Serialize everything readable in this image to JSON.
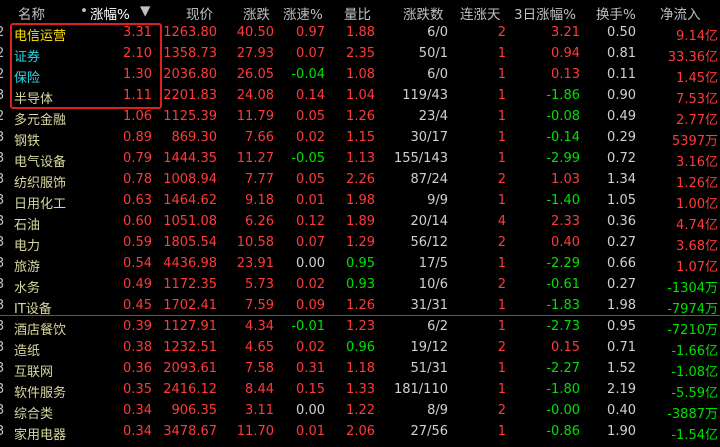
{
  "header": {
    "name": "名称",
    "pct": "涨幅%",
    "price": "现价",
    "chg": "涨跌",
    "speed": "涨速%",
    "vol_ratio": "量比",
    "up_down": "涨跌数",
    "streak": "连涨天",
    "pct3": "3日涨幅%",
    "turnover": "换手%",
    "inflow": "净流入"
  },
  "rows": [
    {
      "idx": "2",
      "name": "电信运营",
      "pct": "3.31",
      "price": "1263.80",
      "chg": "40.50",
      "speed": "0.97",
      "vr": "1.88",
      "ud": "6/0",
      "streak": "2",
      "p3": "3.21",
      "to": "0.50",
      "inflow": "9.14亿",
      "name_color": "yel",
      "speed_color": "red",
      "vr_color": "red",
      "p3_color": "red",
      "inflow_color": "red"
    },
    {
      "idx": "2",
      "name": "证券",
      "pct": "2.10",
      "price": "1358.73",
      "chg": "27.93",
      "speed": "0.07",
      "vr": "2.35",
      "ud": "50/1",
      "streak": "1",
      "p3": "0.94",
      "to": "0.81",
      "inflow": "33.36亿",
      "name_color": "cyan",
      "speed_color": "red",
      "vr_color": "red",
      "p3_color": "red",
      "inflow_color": "red"
    },
    {
      "idx": "2",
      "name": "保险",
      "pct": "1.30",
      "price": "2036.80",
      "chg": "26.05",
      "speed": "-0.04",
      "vr": "1.08",
      "ud": "6/0",
      "streak": "1",
      "p3": "0.13",
      "to": "0.11",
      "inflow": "1.45亿",
      "name_color": "cyan",
      "speed_color": "grn",
      "vr_color": "red",
      "p3_color": "red",
      "inflow_color": "red"
    },
    {
      "idx": "3",
      "name": "半导体",
      "pct": "1.11",
      "price": "2201.83",
      "chg": "24.08",
      "speed": "0.14",
      "vr": "1.04",
      "ud": "119/43",
      "streak": "1",
      "p3": "-1.86",
      "to": "0.90",
      "inflow": "7.53亿",
      "name_color": "yel",
      "speed_color": "red",
      "vr_color": "red",
      "p3_color": "grn",
      "inflow_color": "red"
    },
    {
      "idx": "2",
      "name": "多元金融",
      "pct": "1.06",
      "price": "1125.39",
      "chg": "11.79",
      "speed": "0.05",
      "vr": "1.26",
      "ud": "23/4",
      "streak": "1",
      "p3": "-0.08",
      "to": "0.49",
      "inflow": "2.77亿",
      "name_color": "yel",
      "speed_color": "red",
      "vr_color": "red",
      "p3_color": "grn",
      "inflow_color": "red"
    },
    {
      "idx": "3",
      "name": "钢铁",
      "pct": "0.89",
      "price": "869.30",
      "chg": "7.66",
      "speed": "0.02",
      "vr": "1.15",
      "ud": "30/17",
      "streak": "1",
      "p3": "-0.14",
      "to": "0.29",
      "inflow": "5397万",
      "name_color": "yel",
      "speed_color": "red",
      "vr_color": "red",
      "p3_color": "grn",
      "inflow_color": "red"
    },
    {
      "idx": "3",
      "name": "电气设备",
      "pct": "0.79",
      "price": "1444.35",
      "chg": "11.27",
      "speed": "-0.05",
      "vr": "1.13",
      "ud": "155/143",
      "streak": "1",
      "p3": "-2.99",
      "to": "0.72",
      "inflow": "3.16亿",
      "name_color": "yel",
      "speed_color": "grn",
      "vr_color": "red",
      "p3_color": "grn",
      "inflow_color": "red"
    },
    {
      "idx": "3",
      "name": "纺织服饰",
      "pct": "0.78",
      "price": "1008.94",
      "chg": "7.77",
      "speed": "0.05",
      "vr": "2.26",
      "ud": "87/24",
      "streak": "2",
      "p3": "1.03",
      "to": "1.34",
      "inflow": "1.26亿",
      "name_color": "yel",
      "speed_color": "red",
      "vr_color": "red",
      "p3_color": "red",
      "inflow_color": "red"
    },
    {
      "idx": "3",
      "name": "日用化工",
      "pct": "0.63",
      "price": "1464.62",
      "chg": "9.18",
      "speed": "0.01",
      "vr": "1.98",
      "ud": "9/9",
      "streak": "1",
      "p3": "-1.40",
      "to": "1.05",
      "inflow": "1.00亿",
      "name_color": "yel",
      "speed_color": "red",
      "vr_color": "red",
      "p3_color": "grn",
      "inflow_color": "red"
    },
    {
      "idx": "3",
      "name": "石油",
      "pct": "0.60",
      "price": "1051.08",
      "chg": "6.26",
      "speed": "0.12",
      "vr": "1.89",
      "ud": "20/14",
      "streak": "4",
      "p3": "2.33",
      "to": "0.36",
      "inflow": "4.74亿",
      "name_color": "yel",
      "speed_color": "red",
      "vr_color": "red",
      "p3_color": "red",
      "inflow_color": "red"
    },
    {
      "idx": "3",
      "name": "电力",
      "pct": "0.59",
      "price": "1805.54",
      "chg": "10.58",
      "speed": "0.07",
      "vr": "1.29",
      "ud": "56/12",
      "streak": "2",
      "p3": "0.40",
      "to": "0.27",
      "inflow": "3.68亿",
      "name_color": "yel",
      "speed_color": "red",
      "vr_color": "red",
      "p3_color": "red",
      "inflow_color": "red"
    },
    {
      "idx": "3",
      "name": "旅游",
      "pct": "0.54",
      "price": "4436.98",
      "chg": "23.91",
      "speed": "0.00",
      "vr": "0.95",
      "ud": "17/5",
      "streak": "1",
      "p3": "-2.29",
      "to": "0.66",
      "inflow": "1.07亿",
      "name_color": "yel",
      "speed_color": "wht",
      "vr_color": "grn",
      "p3_color": "grn",
      "inflow_color": "red"
    },
    {
      "idx": "3",
      "name": "水务",
      "pct": "0.49",
      "price": "1172.35",
      "chg": "5.73",
      "speed": "0.02",
      "vr": "0.93",
      "ud": "10/6",
      "streak": "2",
      "p3": "-0.61",
      "to": "0.27",
      "inflow": "-1304万",
      "name_color": "yel",
      "speed_color": "red",
      "vr_color": "grn",
      "p3_color": "grn",
      "inflow_color": "grn"
    },
    {
      "idx": "3",
      "name": "IT设备",
      "pct": "0.45",
      "price": "1702.41",
      "chg": "7.59",
      "speed": "0.09",
      "vr": "1.26",
      "ud": "31/31",
      "streak": "1",
      "p3": "-1.83",
      "to": "1.98",
      "inflow": "-7974万",
      "name_color": "yel",
      "speed_color": "red",
      "vr_color": "red",
      "p3_color": "grn",
      "inflow_color": "grn"
    },
    {
      "idx": "3",
      "name": "酒店餐饮",
      "pct": "0.39",
      "price": "1127.91",
      "chg": "4.34",
      "speed": "-0.01",
      "vr": "1.23",
      "ud": "6/2",
      "streak": "1",
      "p3": "-2.73",
      "to": "0.95",
      "inflow": "-7210万",
      "name_color": "yel",
      "speed_color": "grn",
      "vr_color": "red",
      "p3_color": "grn",
      "inflow_color": "grn"
    },
    {
      "idx": "3",
      "name": "造纸",
      "pct": "0.38",
      "price": "1232.51",
      "chg": "4.65",
      "speed": "0.02",
      "vr": "0.96",
      "ud": "19/12",
      "streak": "2",
      "p3": "0.15",
      "to": "0.71",
      "inflow": "-1.66亿",
      "name_color": "yel",
      "speed_color": "red",
      "vr_color": "grn",
      "p3_color": "red",
      "inflow_color": "grn"
    },
    {
      "idx": "3",
      "name": "互联网",
      "pct": "0.36",
      "price": "2093.61",
      "chg": "7.58",
      "speed": "0.31",
      "vr": "1.18",
      "ud": "51/31",
      "streak": "1",
      "p3": "-2.27",
      "to": "1.52",
      "inflow": "-1.08亿",
      "name_color": "yel",
      "speed_color": "red",
      "vr_color": "red",
      "p3_color": "grn",
      "inflow_color": "grn"
    },
    {
      "idx": "3",
      "name": "软件服务",
      "pct": "0.35",
      "price": "2416.12",
      "chg": "8.44",
      "speed": "0.15",
      "vr": "1.33",
      "ud": "181/110",
      "streak": "1",
      "p3": "-1.80",
      "to": "2.19",
      "inflow": "-5.59亿",
      "name_color": "yel",
      "speed_color": "red",
      "vr_color": "red",
      "p3_color": "grn",
      "inflow_color": "grn"
    },
    {
      "idx": "3",
      "name": "综合类",
      "pct": "0.34",
      "price": "906.35",
      "chg": "3.11",
      "speed": "0.00",
      "vr": "1.22",
      "ud": "8/9",
      "streak": "2",
      "p3": "-0.00",
      "to": "0.40",
      "inflow": "-3887万",
      "name_color": "yel",
      "speed_color": "wht",
      "vr_color": "red",
      "p3_color": "grn",
      "inflow_color": "grn"
    },
    {
      "idx": "3",
      "name": "家用电器",
      "pct": "0.34",
      "price": "3478.67",
      "chg": "11.70",
      "speed": "0.01",
      "vr": "2.06",
      "ud": "27/56",
      "streak": "1",
      "p3": "-0.86",
      "to": "1.90",
      "inflow": "-1.54亿",
      "name_color": "yel",
      "speed_color": "red",
      "vr_color": "red",
      "p3_color": "grn",
      "inflow_color": "grn"
    }
  ],
  "colors": {
    "background": "#000000",
    "up": "#ff3a3a",
    "down": "#00e000",
    "name": "#d8d8a0",
    "selected_name": "#2ad8e8",
    "highlight_border": "#e0201c",
    "separator": "#7a5a14"
  },
  "icons": {
    "sort": "sort-desc-icon",
    "dot": "dot-icon"
  }
}
